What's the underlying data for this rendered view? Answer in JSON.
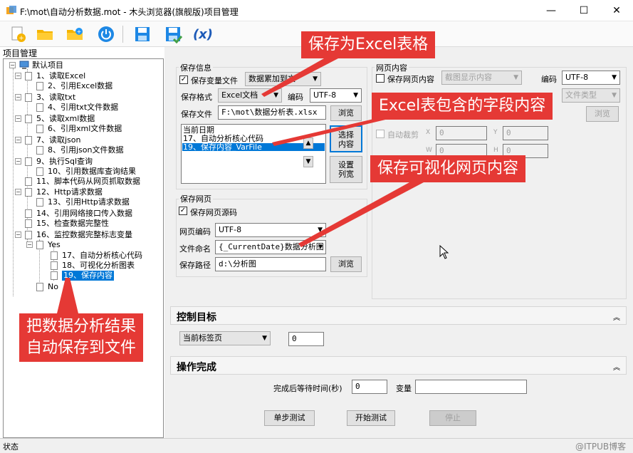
{
  "window": {
    "title": "F:\\mot\\自动分析数据.mot - 木头浏览器(旗舰版)项目管理",
    "minimize": "—",
    "maximize": "☐",
    "close": "✕"
  },
  "toolbar": {
    "icons": [
      "new-file-icon",
      "open-folder-icon",
      "add-folder-icon",
      "power-icon",
      "save-icon",
      "save-as-icon",
      "function-icon"
    ],
    "function_label": "(x)"
  },
  "tree": {
    "header": "项目管理",
    "root": "默认项目",
    "items": [
      "1、读取Excel",
      "2、引用Excel数据",
      "3、读取txt",
      "4、引用txt文件数据",
      "5、读取xml数据",
      "6、引用xml文件数据",
      "7、读取json",
      "8、引用json文件数据",
      "9、执行Sql查询",
      "10、引用数据库查询结果",
      "11、脚本代码从网页抓取数据",
      "12、Http请求数据",
      "13、引用Http请求数据",
      "14、引用网络接口传入数据",
      "15、检查数据完整性",
      "16、监控数据完整标志变量",
      "Yes",
      "17、自动分析核心代码",
      "18、可视化分析图表",
      "19、保存内容",
      "No"
    ]
  },
  "save_info": {
    "group_label": "保存信息",
    "save_var_file_label": "保存变量文件",
    "save_var_file_checked": true,
    "append_mode": "数据累加到文",
    "format_label": "保存格式",
    "format_value": "Excel文档",
    "encoding_label": "编码",
    "encoding_value": "UTF-8",
    "file_label": "保存文件",
    "file_value": "F:\\mot\\数据分析表.xlsx",
    "browse": "浏览",
    "fields": [
      "当前日期",
      "17、自动分析核心代码",
      "19、保存内容_VarFile"
    ],
    "selected_field_index": 2,
    "select_content_button": "选择\n内容",
    "set_columns_button": "设置\n列宽"
  },
  "save_page": {
    "group_label": "保存网页",
    "save_source_label": "保存网页源码",
    "save_source_checked": true,
    "encoding_label": "网页编码",
    "encoding_value": "UTF-8",
    "naming_label": "文件命名",
    "naming_value": "{_CurrentDate}数据分析图",
    "path_label": "保存路径",
    "path_value": "d:\\分析图",
    "browse": "浏览"
  },
  "page_content": {
    "group_label": "网页内容",
    "save_content_label": "保存网页内容",
    "save_content_checked": false,
    "display_mode": "截图显示内容",
    "encoding_label": "编码",
    "encoding_value": "UTF-8",
    "file_type": "文件类型",
    "browse": "浏览",
    "auto_crop_label": "自动裁剪",
    "x_label": "X",
    "y_label": "Y",
    "w_label": "W",
    "h_label": "H",
    "x_value": "0",
    "y_value": "0",
    "w_value": "0",
    "h_value": "0"
  },
  "control_target": {
    "title": "控制目标",
    "target_value": "当前标签页",
    "index_value": "0"
  },
  "operation_done": {
    "title": "操作完成",
    "wait_label": "完成后等待时间(秒)",
    "wait_value": "0",
    "var_label": "变量",
    "var_value": ""
  },
  "buttons": {
    "step_test": "单步测试",
    "start_test": "开始测试",
    "stop": "停止"
  },
  "callouts": {
    "excel": "保存为Excel表格",
    "fields": "Excel表包含的字段内容",
    "web": "保存可视化网页内容",
    "auto_save_line1": "把数据分析结果",
    "auto_save_line2": "自动保存到文件"
  },
  "status": {
    "label": "状态",
    "watermark": "@ITPUB博客"
  },
  "colors": {
    "selection": "#0078d7",
    "callout": "#e53935"
  }
}
